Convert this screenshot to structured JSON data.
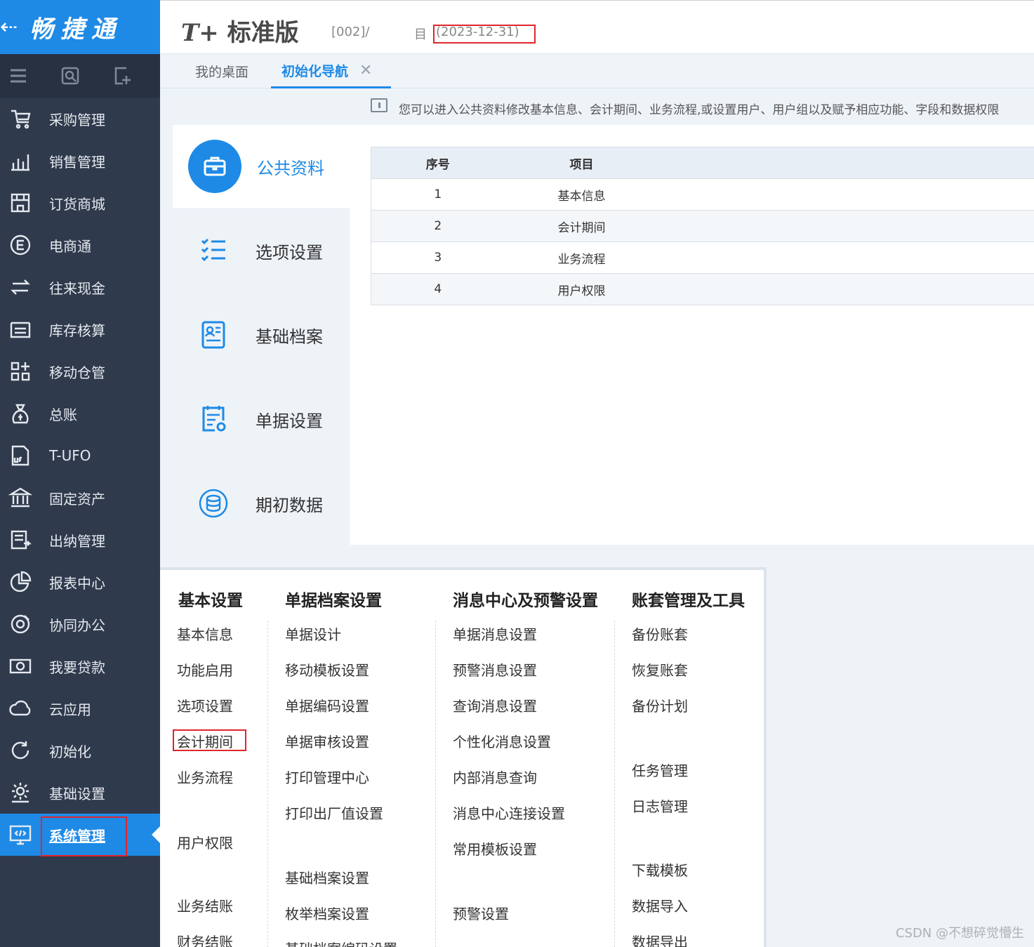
{
  "brand": {
    "back": "⇠",
    "name": "畅捷通"
  },
  "sidebar_tools": [
    "menu-icon",
    "search-icon",
    "add-icon"
  ],
  "menu": [
    {
      "label": "采购管理",
      "icon": "cart-icon"
    },
    {
      "label": "销售管理",
      "icon": "chart-bars-icon"
    },
    {
      "label": "订货商城",
      "icon": "store-icon"
    },
    {
      "label": "电商通",
      "icon": "e-circle-icon"
    },
    {
      "label": "往来现金",
      "icon": "exchange-icon"
    },
    {
      "label": "库存核算",
      "icon": "warehouse-icon"
    },
    {
      "label": "移动仓管",
      "icon": "grid-plus-icon"
    },
    {
      "label": "总账",
      "icon": "money-bag-icon"
    },
    {
      "label": "T-UFO",
      "icon": "ufo-file-icon"
    },
    {
      "label": "固定资产",
      "icon": "bank-icon"
    },
    {
      "label": "出纳管理",
      "icon": "cashier-icon"
    },
    {
      "label": "报表中心",
      "icon": "pie-icon"
    },
    {
      "label": "协同办公",
      "icon": "cowork-icon"
    },
    {
      "label": "我要贷款",
      "icon": "cash-icon"
    },
    {
      "label": "云应用",
      "icon": "cloud-icon"
    },
    {
      "label": "初始化",
      "icon": "refresh-icon"
    },
    {
      "label": "基础设置",
      "icon": "gear-icon"
    },
    {
      "label": "系统管理",
      "icon": "monitor-code-icon",
      "active": true
    }
  ],
  "header": {
    "logo_t": "T+",
    "logo_text": "标准版",
    "account": "[002]/",
    "account_icon": "目",
    "date": "(2023-12-31)"
  },
  "tabs": {
    "home": "我的桌面",
    "init": "初始化导航",
    "close": "✕"
  },
  "hint": "您可以进入公共资料修改基本信息、会计期间、业务流程,或设置用户、用户组以及赋予相应功能、字段和数据权限",
  "nav": [
    {
      "label": "公共资料",
      "icon": "briefcase-icon",
      "active": true
    },
    {
      "label": "选项设置",
      "icon": "checklist-icon"
    },
    {
      "label": "基础档案",
      "icon": "profile-card-icon"
    },
    {
      "label": "单据设置",
      "icon": "doc-gear-icon"
    },
    {
      "label": "期初数据",
      "icon": "database-icon"
    }
  ],
  "table": {
    "headers": [
      "序号",
      "项目"
    ],
    "rows": [
      [
        "1",
        "基本信息"
      ],
      [
        "2",
        "会计期间"
      ],
      [
        "3",
        "业务流程"
      ],
      [
        "4",
        "用户权限"
      ]
    ]
  },
  "panel": {
    "basic": {
      "title": "基本设置",
      "items": [
        "基本信息",
        "功能启用",
        "选项设置",
        "会计期间",
        "业务流程",
        "用户权限",
        "业务结账",
        "财务结账"
      ]
    },
    "docs": {
      "title": "单据档案设置",
      "items": [
        "单据设计",
        "移动模板设置",
        "单据编码设置",
        "单据审核设置",
        "打印管理中心",
        "打印出厂值设置",
        "基础档案设置",
        "枚举档案设置",
        "基础档案编码设置"
      ]
    },
    "msg": {
      "title": "消息中心及预警设置",
      "items": [
        "单据消息设置",
        "预警消息设置",
        "查询消息设置",
        "个性化消息设置",
        "内部消息查询",
        "消息中心连接设置",
        "常用模板设置",
        "预警设置"
      ]
    },
    "acct": {
      "title": "账套管理及工具",
      "items": [
        "备份账套",
        "恢复账套",
        "备份计划",
        "任务管理",
        "日志管理",
        "下载模板",
        "数据导入",
        "数据导出"
      ]
    }
  },
  "watermark": "CSDN @不想碎觉懵生",
  "colors": {
    "brand_blue": "#1e8ae6",
    "sidebar": "#2f3a4c",
    "highlight_red": "#e0262d"
  }
}
